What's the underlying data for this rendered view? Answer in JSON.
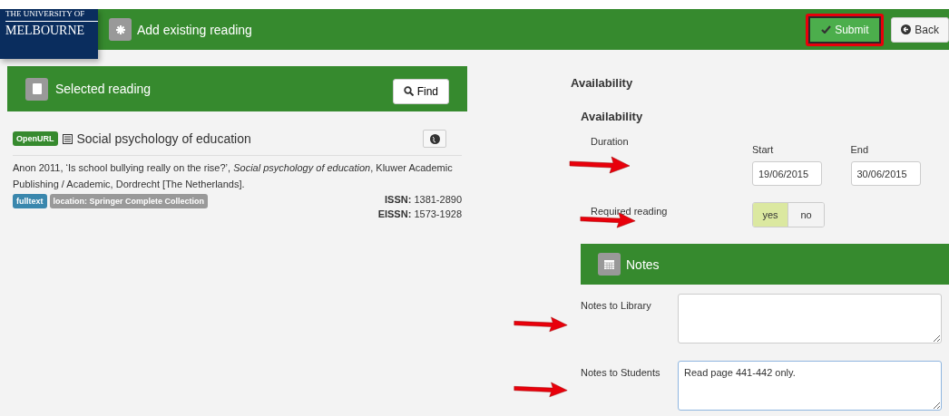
{
  "logo": {
    "line_1": "THE UNIVERSITY OF",
    "line_2": "MELBOURNE"
  },
  "header": {
    "title": "Add existing reading",
    "buttons": [
      {
        "label": "Submit",
        "kind": "primary",
        "highlighted": true
      },
      {
        "label": "Back",
        "kind": "default",
        "highlighted": false
      }
    ]
  },
  "selected_reading": {
    "title": "Selected reading",
    "find_button": "Find",
    "source_badge": "OpenURL",
    "item_title": "Social psychology of education",
    "citation": "Anon 2011, ‘Is school bullying really on the rise?’, *Social psychology of education*, Kluwer Academic Publishing / Academic, Dordrecht [The Netherlands].",
    "tags": [
      {
        "label": "fulltext",
        "color": "#3a87ad"
      },
      {
        "label": "location: Springer Complete Collection",
        "color": "#999999"
      }
    ],
    "identifiers": [
      {
        "label": "ISSN:",
        "value": "1381-2890"
      },
      {
        "label": "EISSN:",
        "value": "1573-1928"
      }
    ]
  },
  "availability": {
    "heading": "Availability",
    "subheading": "Availability",
    "duration_label": "Duration",
    "start_label": "Start",
    "start_value": "19/06/2015",
    "end_label": "End",
    "end_value": "30/06/2015",
    "required_label": "Required reading",
    "required_options": [
      {
        "label": "yes",
        "selected": true
      },
      {
        "label": "no",
        "selected": false
      }
    ]
  },
  "notes": {
    "title": "Notes",
    "library_label": "Notes to Library",
    "students_label": "Notes to Students",
    "students_value": "Read page 441-442 only."
  }
}
